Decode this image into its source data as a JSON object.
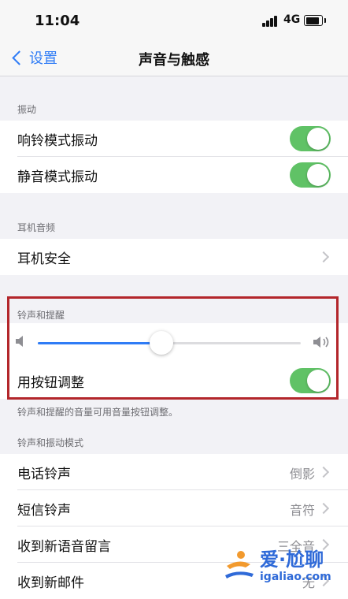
{
  "status_bar": {
    "time": "11:04",
    "network": "4G"
  },
  "nav": {
    "back_label": "设置",
    "title": "声音与触感"
  },
  "vibration": {
    "header": "振动",
    "items": [
      {
        "label": "响铃模式振动",
        "on": true
      },
      {
        "label": "静音模式振动",
        "on": true
      }
    ]
  },
  "headphone": {
    "header": "耳机音频",
    "items": [
      {
        "label": "耳机安全"
      }
    ]
  },
  "ringer": {
    "header": "铃声和提醒",
    "volume_level": 0.47,
    "button_adjust": {
      "label": "用按钮调整",
      "on": true
    },
    "footnote": "铃声和提醒的音量可用音量按钮调整。"
  },
  "patterns": {
    "header": "铃声和振动模式",
    "items": [
      {
        "label": "电话铃声",
        "value": "倒影"
      },
      {
        "label": "短信铃声",
        "value": "音符"
      },
      {
        "label": "收到新语音留言",
        "value": "三全音"
      },
      {
        "label": "收到新邮件",
        "value": "无"
      }
    ]
  },
  "watermark": {
    "title": "爱·尬聊",
    "url": "igaliao.com"
  },
  "colors": {
    "accent": "#2f7cf6",
    "switch_on": "#60c266",
    "highlight": "#b3262b"
  }
}
